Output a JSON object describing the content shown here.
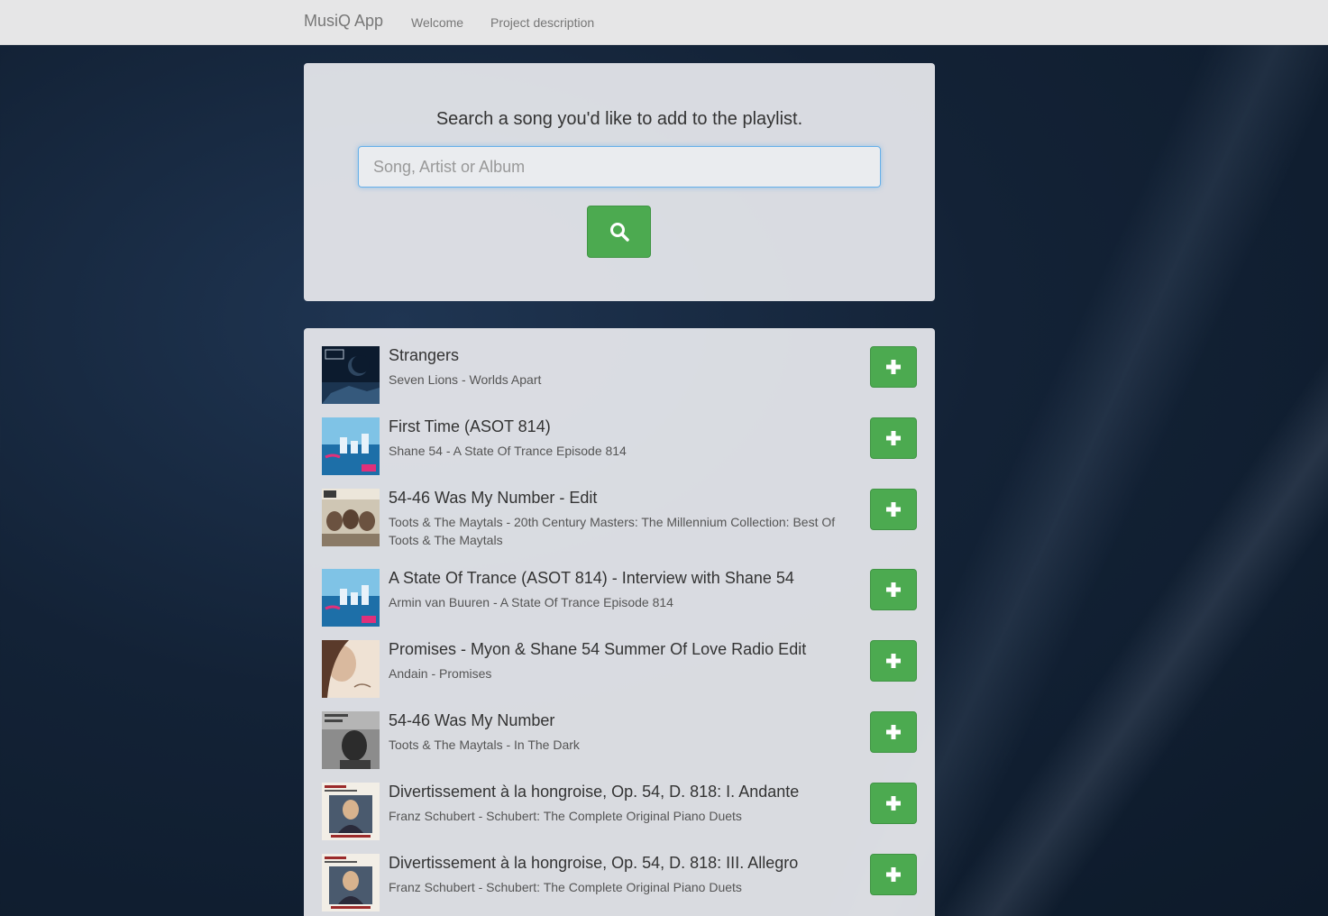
{
  "navbar": {
    "brand": "MusiQ App",
    "links": [
      "Welcome",
      "Project description"
    ]
  },
  "search": {
    "title": "Search a song you'd like to add to the playlist.",
    "placeholder": "Song, Artist or Album",
    "button_icon": "search-icon"
  },
  "results": [
    {
      "title": "Strangers",
      "subtitle": "Seven Lions - Worlds Apart",
      "cover": "seven-lions-cover",
      "action_icon": "plus-icon"
    },
    {
      "title": "First Time (ASOT 814)",
      "subtitle": "Shane 54 - A State Of Trance Episode 814",
      "cover": "asot-814-cover",
      "action_icon": "plus-icon"
    },
    {
      "title": "54-46 Was My Number - Edit",
      "subtitle": "Toots & The Maytals - 20th Century Masters: The Millennium Collection: Best Of Toots & The Maytals",
      "cover": "toots-millennium-cover",
      "action_icon": "plus-icon"
    },
    {
      "title": "A State Of Trance (ASOT 814) - Interview with Shane 54",
      "subtitle": "Armin van Buuren - A State Of Trance Episode 814",
      "cover": "asot-814-cover",
      "action_icon": "plus-icon"
    },
    {
      "title": "Promises - Myon & Shane 54 Summer Of Love Radio Edit",
      "subtitle": "Andain - Promises",
      "cover": "andain-promises-cover",
      "action_icon": "plus-icon"
    },
    {
      "title": "54-46 Was My Number",
      "subtitle": "Toots & The Maytals - In The Dark",
      "cover": "toots-in-the-dark-cover",
      "action_icon": "plus-icon"
    },
    {
      "title": "Divertissement à la hongroise, Op. 54, D. 818: I. Andante",
      "subtitle": "Franz Schubert - Schubert: The Complete Original Piano Duets",
      "cover": "schubert-piano-duets-cover",
      "action_icon": "plus-icon"
    },
    {
      "title": "Divertissement à la hongroise, Op. 54, D. 818: III. Allegro",
      "subtitle": "Franz Schubert - Schubert: The Complete Original Piano Duets",
      "cover": "schubert-piano-duets-cover",
      "action_icon": "plus-icon"
    }
  ],
  "colors": {
    "accent_green": "#4caa50",
    "navbar_bg": "#e6e6e7",
    "panel_bg": "#e8eaee"
  }
}
